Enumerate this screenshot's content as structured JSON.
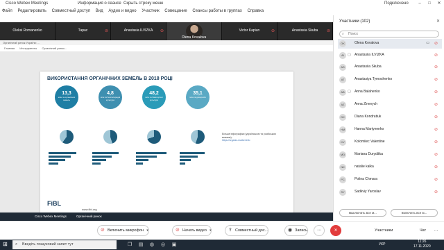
{
  "titlebar": {
    "app_title": "Cisco Webex Meetings",
    "info_label": "Информация о сеансе",
    "hide_menu_label": "Скрыть строку меню",
    "connected_label": "Подключено"
  },
  "menubar": [
    "Файл",
    "Редактировать",
    "Совместный доступ",
    "Вид",
    "Аудио и видео",
    "Участник",
    "Совещание",
    "Сеансы работы в группах",
    "Справка"
  ],
  "strip": {
    "tiles": [
      {
        "name": "Oleksi Romanenko"
      },
      {
        "name": "Тарас"
      },
      {
        "name": "Anastasia ILVIZKA"
      },
      {
        "name": "Olena Kovalova"
      },
      {
        "name": "Victor Kapiun"
      },
      {
        "name": "Anastasia Skuba"
      }
    ]
  },
  "viewer": {
    "doc_title": "Органічний ринок України: ...",
    "toolbar": [
      "Главная",
      "Инструменты",
      "Органічний ринок..."
    ],
    "slide": {
      "title": "ВИКОРИСТАННЯ ОРГАНІЧНИХ ЗЕМЕЛЬ В 2018 РОЦІ",
      "columns": [
        {
          "value": "13,3",
          "sub": "млн га органічних земель",
          "color": "#1e7ea4"
        },
        {
          "value": "4,8",
          "sub": "млн га безпосередні культури",
          "color": "#3e8fb0"
        },
        {
          "value": "48,2",
          "sub": "млн га багаторічні культури",
          "color": "#2a9bb8"
        },
        {
          "value": "35,1",
          "sub": "млн га дикоросів",
          "color": "#5aa9c4"
        }
      ],
      "brand": "FiBL",
      "site": "www.fibl.org",
      "notes_text": "Більше інфографіки (українською та російською мовами):",
      "notes_link": "https://organic-market.info"
    }
  },
  "panel": {
    "title": "Участники (102)",
    "search_placeholder": "Поиск",
    "participants": [
      {
        "initials": "OK",
        "name": "Olena Kovalova"
      },
      {
        "initials": "AI",
        "name": "Anastasiia ILVIZKA"
      },
      {
        "initials": "AS",
        "name": "Anastasiia Skuba"
      },
      {
        "initials": "AT",
        "name": "Anastasiya Tymoshenko"
      },
      {
        "initials": "AB",
        "name": "Anna Balahenko"
      },
      {
        "initials": "AZ",
        "name": "Anna Zinevych"
      },
      {
        "initials": "DK",
        "name": "Diana Kondratiuk"
      },
      {
        "initials": "HM",
        "name": "Hanna Martynenko"
      },
      {
        "initials": "KV",
        "name": "Kolomiiec Valentine"
      },
      {
        "initials": "MD",
        "name": "Mariana Durydāka"
      },
      {
        "initials": "NK",
        "name": "natalie kalka"
      },
      {
        "initials": "PC",
        "name": "Polina Chmara"
      },
      {
        "initials": "SY",
        "name": "Sadkviy Yaroslav"
      }
    ],
    "btn_mute_all": "Выключить все м...",
    "btn_unmute_all": "Включить все м..."
  },
  "controls": {
    "mic": "Включить микрофон",
    "video": "Начать видео",
    "share": "Совместный дос...",
    "record": "Запись",
    "participants": "Участники",
    "chat": "Чат"
  },
  "taskbar": {
    "search_placeholder": "Введіть пошуковий запит тут",
    "lang": "УКР",
    "time": "11:26",
    "date": "17.11.2020"
  },
  "strip2": {
    "tabs": [
      "Cisco Webex Meetings",
      "Органічний ринок"
    ]
  }
}
